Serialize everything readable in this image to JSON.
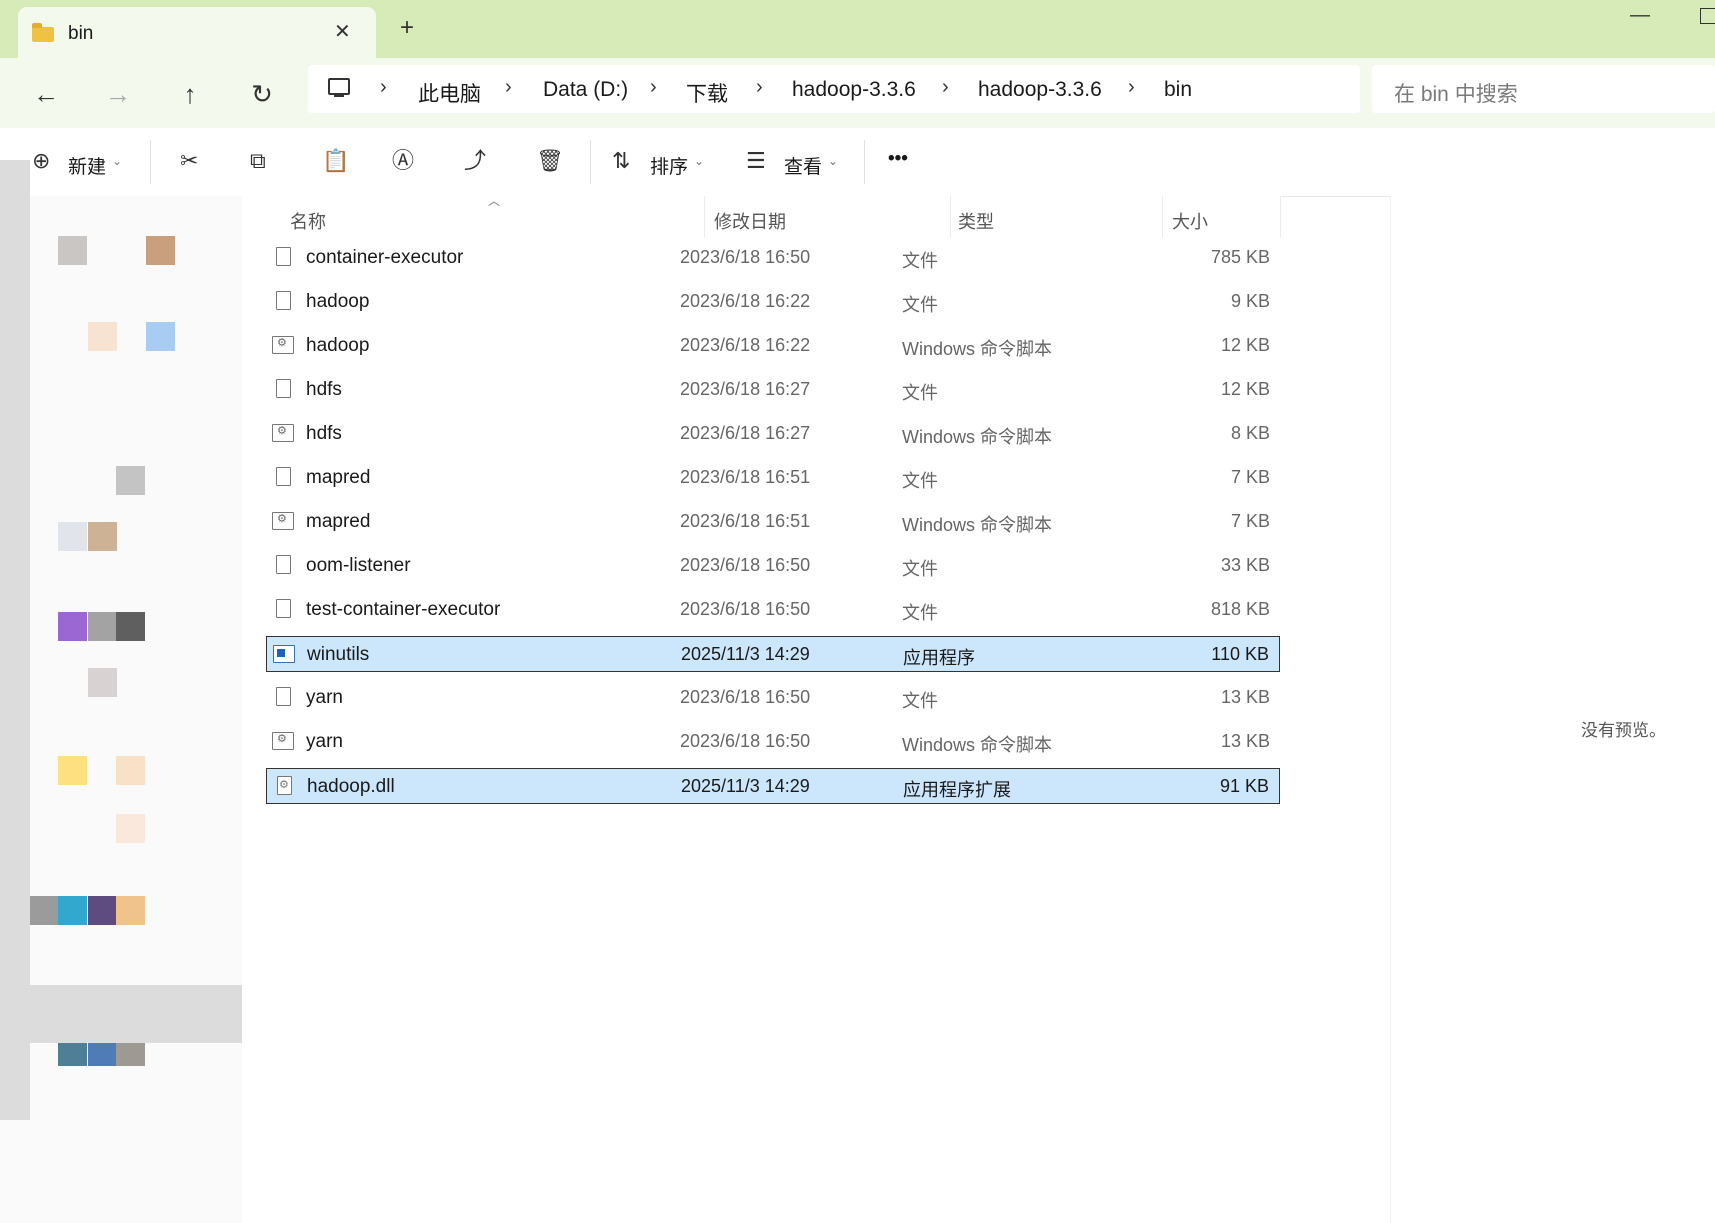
{
  "tab": {
    "title": "bin",
    "close_icon": "close-icon",
    "new_tab": "+"
  },
  "nav": {
    "back_icon": "←",
    "forward_icon": "→",
    "up_icon": "↑",
    "refresh_icon": "↻",
    "breadcrumbs": [
      "此电脑",
      "Data (D:)",
      "下载",
      "hadoop-3.3.6",
      "hadoop-3.3.6",
      "bin"
    ],
    "search_placeholder": "在 bin 中搜索"
  },
  "commands": {
    "new_label": "新建",
    "sort_label": "排序",
    "view_label": "查看",
    "more_label": "•••"
  },
  "columns": {
    "name": "名称",
    "date": "修改日期",
    "type": "类型",
    "size": "大小"
  },
  "files": [
    {
      "name": "container-executor",
      "date": "2023/6/18 16:50",
      "type": "文件",
      "size": "785 KB",
      "icon": "file-icon",
      "selected": false
    },
    {
      "name": "hadoop",
      "date": "2023/6/18 16:22",
      "type": "文件",
      "size": "9 KB",
      "icon": "file-icon",
      "selected": false
    },
    {
      "name": "hadoop",
      "date": "2023/6/18 16:22",
      "type": "Windows 命令脚本",
      "size": "12 KB",
      "icon": "script-icon",
      "selected": false
    },
    {
      "name": "hdfs",
      "date": "2023/6/18 16:27",
      "type": "文件",
      "size": "12 KB",
      "icon": "file-icon",
      "selected": false
    },
    {
      "name": "hdfs",
      "date": "2023/6/18 16:27",
      "type": "Windows 命令脚本",
      "size": "8 KB",
      "icon": "script-icon",
      "selected": false
    },
    {
      "name": "mapred",
      "date": "2023/6/18 16:51",
      "type": "文件",
      "size": "7 KB",
      "icon": "file-icon",
      "selected": false
    },
    {
      "name": "mapred",
      "date": "2023/6/18 16:51",
      "type": "Windows 命令脚本",
      "size": "7 KB",
      "icon": "script-icon",
      "selected": false
    },
    {
      "name": "oom-listener",
      "date": "2023/6/18 16:50",
      "type": "文件",
      "size": "33 KB",
      "icon": "file-icon",
      "selected": false
    },
    {
      "name": "test-container-executor",
      "date": "2023/6/18 16:50",
      "type": "文件",
      "size": "818 KB",
      "icon": "file-icon",
      "selected": false
    },
    {
      "name": "winutils",
      "date": "2025/11/3 14:29",
      "type": "应用程序",
      "size": "110 KB",
      "icon": "application-icon",
      "selected": true
    },
    {
      "name": "yarn",
      "date": "2023/6/18 16:50",
      "type": "文件",
      "size": "13 KB",
      "icon": "file-icon",
      "selected": false
    },
    {
      "name": "yarn",
      "date": "2023/6/18 16:50",
      "type": "Windows 命令脚本",
      "size": "13 KB",
      "icon": "script-icon",
      "selected": false
    },
    {
      "name": "hadoop.dll",
      "date": "2025/11/3 14:29",
      "type": "应用程序扩展",
      "size": "91 KB",
      "icon": "dll-icon",
      "selected": true
    }
  ],
  "preview": {
    "message": "没有预览。"
  },
  "sidebar_blocks": [
    "#c9c6c4",
    "#c9a07e",
    "#f6e3d2",
    "#a9cdf2",
    "#c4c4c4",
    "#e1e4ea",
    "#cdb296",
    "#9b68d3",
    "#a3a3a3",
    "#5f5f5f",
    "#d8d3d2",
    "#fde07f",
    "#f7e2c7",
    "#fbe8dc",
    "#9b9b9b",
    "#33a8cf",
    "#5e4b7f",
    "#f0c38d",
    "#4f7f94",
    "#4f7bb6",
    "#9e9a93"
  ]
}
